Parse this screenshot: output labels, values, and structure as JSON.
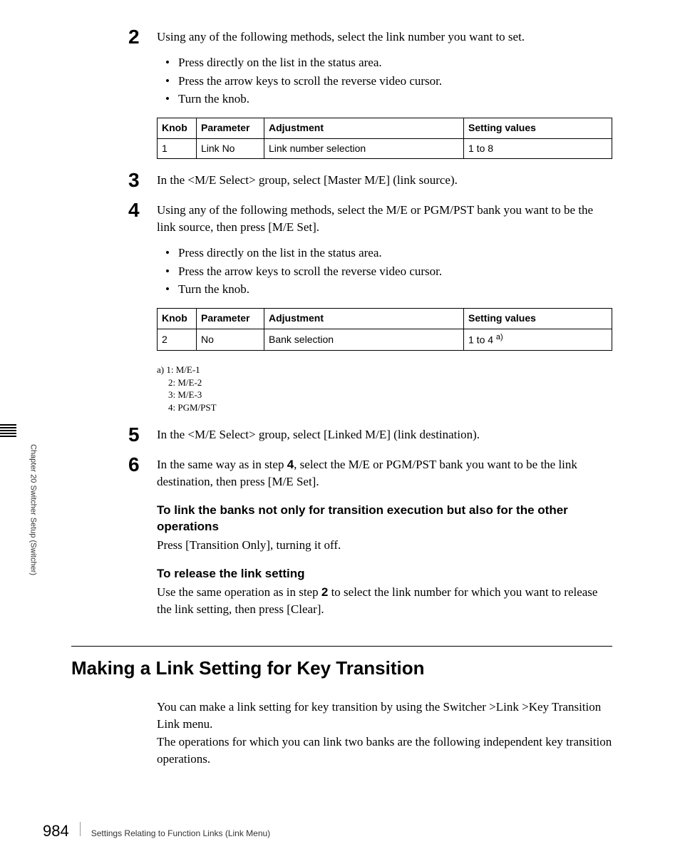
{
  "sidebar": {
    "vertical_label": "Chapter 20  Switcher Setup (Switcher)"
  },
  "steps": {
    "s2": {
      "num": "2",
      "text": "Using any of the following methods, select the link number you want to set.",
      "bullets": [
        "Press directly on the list in the status area.",
        "Press the arrow keys to scroll the reverse video cursor.",
        "Turn the knob."
      ]
    },
    "s3": {
      "num": "3",
      "text": "In the <M/E Select> group, select [Master M/E] (link source)."
    },
    "s4": {
      "num": "4",
      "text": "Using any of the following methods, select the M/E or PGM/PST bank you want to be the link source, then press [M/E Set].",
      "bullets": [
        "Press directly on the list in the status area.",
        "Press the arrow keys to scroll the reverse video cursor.",
        "Turn the knob."
      ]
    },
    "s5": {
      "num": "5",
      "text": "In the <M/E Select> group, select [Linked M/E] (link destination)."
    },
    "s6": {
      "num": "6",
      "text_before": "In the same way as in step ",
      "text_bold": "4",
      "text_after": ", select the M/E or PGM/PST bank you want to be the link destination, then press [M/E Set]."
    }
  },
  "table1": {
    "headers": {
      "knob": "Knob",
      "parameter": "Parameter",
      "adjustment": "Adjustment",
      "setting": "Setting values"
    },
    "row": {
      "knob": "1",
      "parameter": "Link No",
      "adjustment": "Link number selection",
      "setting": "1 to 8"
    }
  },
  "table2": {
    "headers": {
      "knob": "Knob",
      "parameter": "Parameter",
      "adjustment": "Adjustment",
      "setting": "Setting values"
    },
    "row": {
      "knob": "2",
      "parameter": "No",
      "adjustment": "Bank selection",
      "setting_prefix": "1 to 4 ",
      "setting_sup": "a)"
    }
  },
  "footnote": {
    "line1": "a) 1: M/E-1",
    "line2": "2: M/E-2",
    "line3": "3: M/E-3",
    "line4": "4: PGM/PST"
  },
  "sub1": {
    "heading": "To link the banks not only for transition execution but also for the other operations",
    "text": "Press [Transition Only], turning it off."
  },
  "sub2": {
    "heading": "To release the link setting",
    "text_before": "Use the same operation as in step ",
    "text_bold": "2",
    "text_after": " to select the link number for which you want to release the link setting, then press [Clear]."
  },
  "section": {
    "heading": "Making a Link Setting for Key Transition",
    "p1": "You can make a link setting for key transition by using the Switcher >Link >Key Transition Link menu.",
    "p2": "The operations for which you can link two banks are the following independent key transition operations."
  },
  "footer": {
    "page": "984",
    "text": "Settings Relating to Function Links (Link Menu)"
  }
}
